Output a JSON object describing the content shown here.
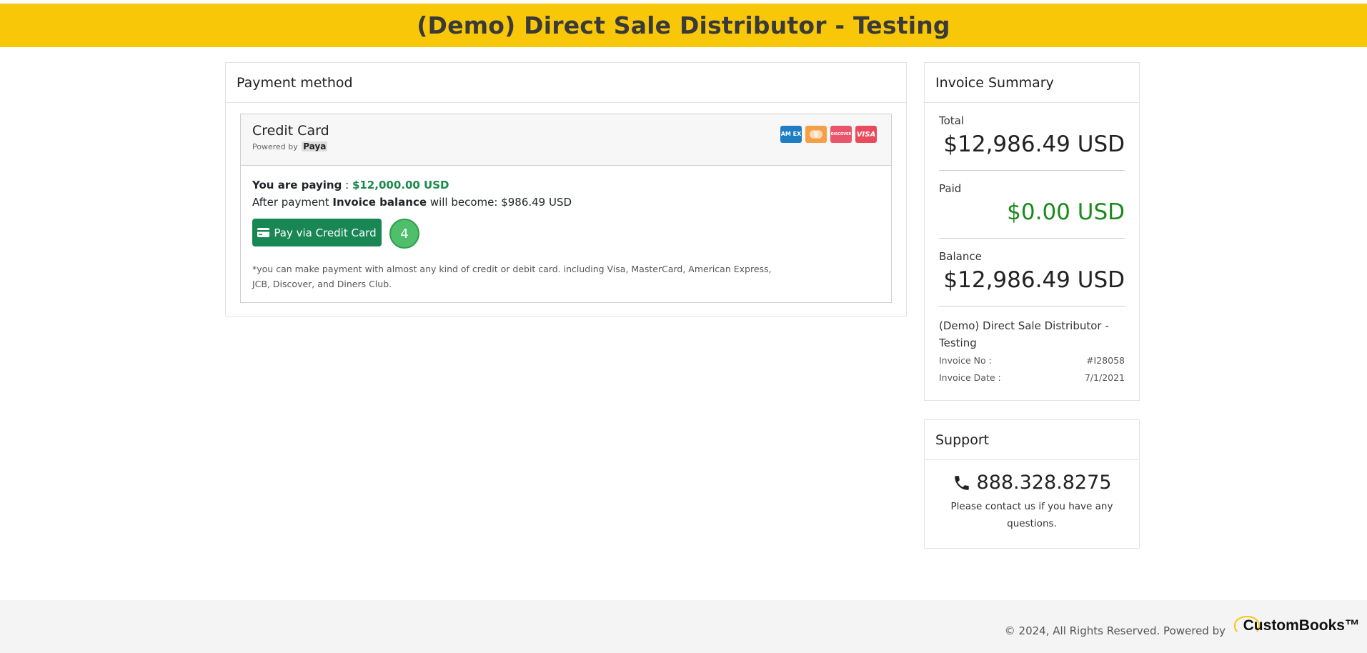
{
  "header": {
    "title": "(Demo) Direct Sale Distributor - Testing"
  },
  "payment": {
    "card_title": "Payment method",
    "method_title": "Credit Card",
    "powered_by_label": "Powered by",
    "powered_by_brand": "Paya",
    "card_logos": [
      {
        "name": "amex-logo",
        "label": "AM EX",
        "color": "#1f7dc4"
      },
      {
        "name": "mastercard-logo",
        "label": "",
        "color": "#f5a046"
      },
      {
        "name": "discover-logo",
        "label": "DISCOVER",
        "color": "#e9556b"
      },
      {
        "name": "visa-logo",
        "label": "VISA",
        "color": "#e94a5c"
      }
    ],
    "paying_label": "You are paying",
    "paying_separator": " : ",
    "paying_amount": "$12,000.00 USD",
    "after_prefix": "After payment",
    "after_bold": "Invoice balance",
    "after_suffix": "will become: $986.49 USD",
    "pay_button_label": "Pay via Credit Card",
    "step_badge": "4",
    "note": "*you can make payment with almost any kind of credit or debit card. including Visa, MasterCard, American Express, JCB, Discover, and Diners Club."
  },
  "summary": {
    "title": "Invoice Summary",
    "total_label": "Total",
    "total_value": "$12,986.49 USD",
    "paid_label": "Paid",
    "paid_value": "$0.00 USD",
    "balance_label": "Balance",
    "balance_value": "$12,986.49 USD",
    "company": "(Demo) Direct Sale Distributor - Testing",
    "invoice_no_label": "Invoice No :",
    "invoice_no_value": "#I28058",
    "invoice_date_label": "Invoice Date :",
    "invoice_date_value": "7/1/2021"
  },
  "support": {
    "title": "Support",
    "phone": "888.328.8275",
    "text": "Please contact us if you have any questions."
  },
  "footer": {
    "text": "© 2024, All Rights Reserved. Powered by",
    "brand": "CustomBooks™"
  }
}
